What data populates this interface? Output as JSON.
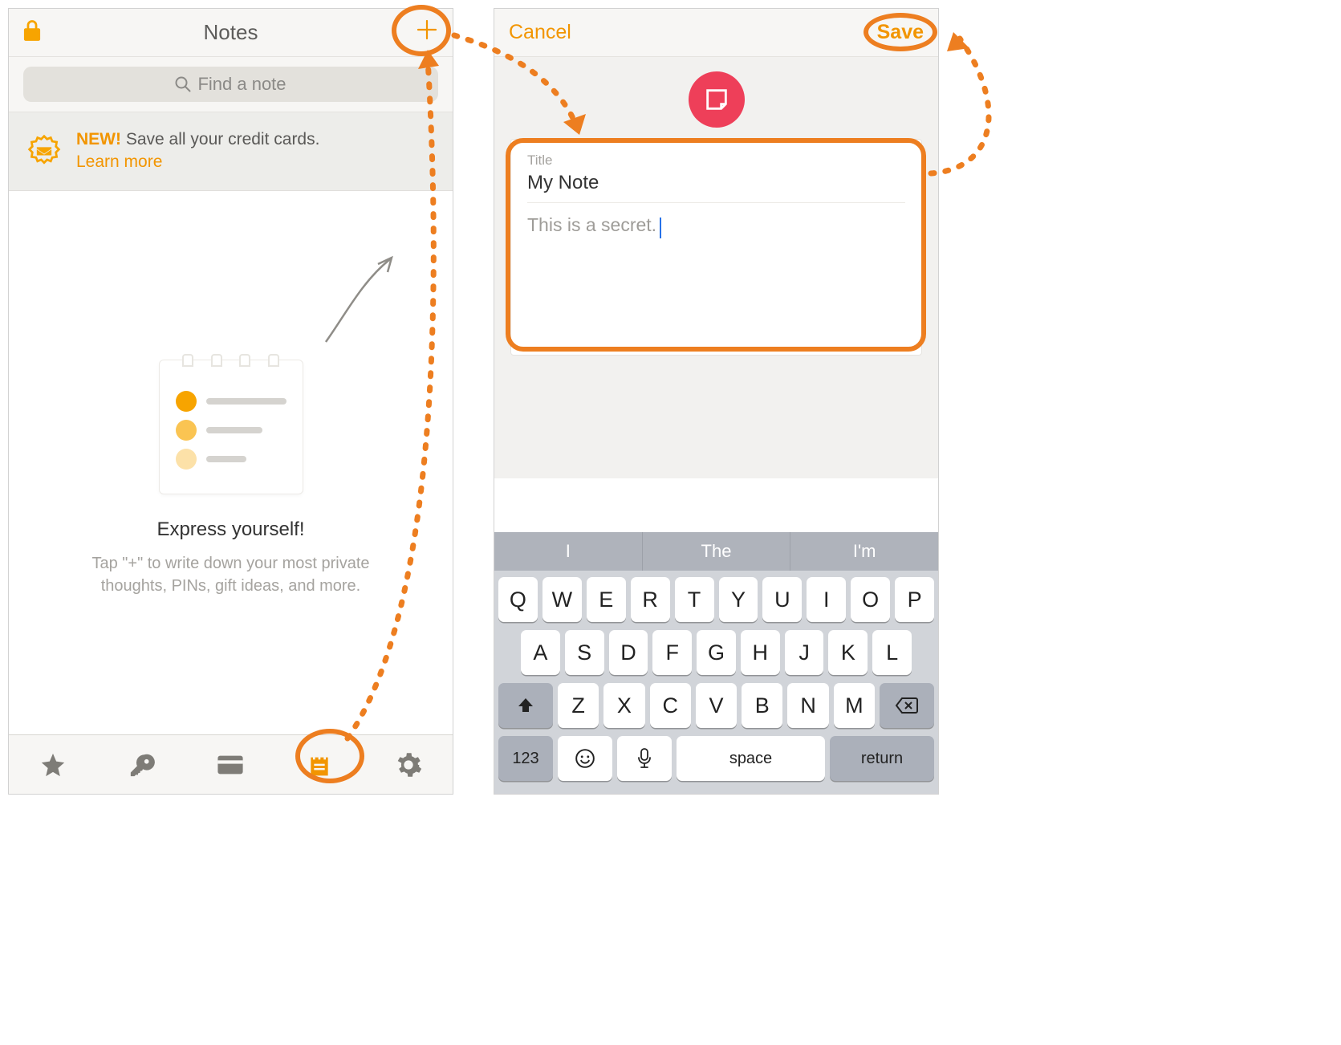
{
  "left": {
    "navbar": {
      "title": "Notes"
    },
    "search": {
      "placeholder": "Find a note"
    },
    "promo": {
      "new": "NEW!",
      "text": "Save all your credit cards.",
      "learn": "Learn more"
    },
    "empty": {
      "heading": "Express yourself!",
      "sub": "Tap \"+\" to write down your most private thoughts, PINs, gift ideas, and more."
    }
  },
  "right": {
    "navbar": {
      "cancel": "Cancel",
      "save": "Save"
    },
    "note": {
      "title_label": "Title",
      "title_value": "My Note",
      "body_value": "This is a secret."
    }
  },
  "keyboard": {
    "suggestions": [
      "I",
      "The",
      "I'm"
    ],
    "row1": [
      "Q",
      "W",
      "E",
      "R",
      "T",
      "Y",
      "U",
      "I",
      "O",
      "P"
    ],
    "row2": [
      "A",
      "S",
      "D",
      "F",
      "G",
      "H",
      "J",
      "K",
      "L"
    ],
    "row3": [
      "Z",
      "X",
      "C",
      "V",
      "B",
      "N",
      "M"
    ],
    "numkey": "123",
    "space": "space",
    "return": "return"
  }
}
